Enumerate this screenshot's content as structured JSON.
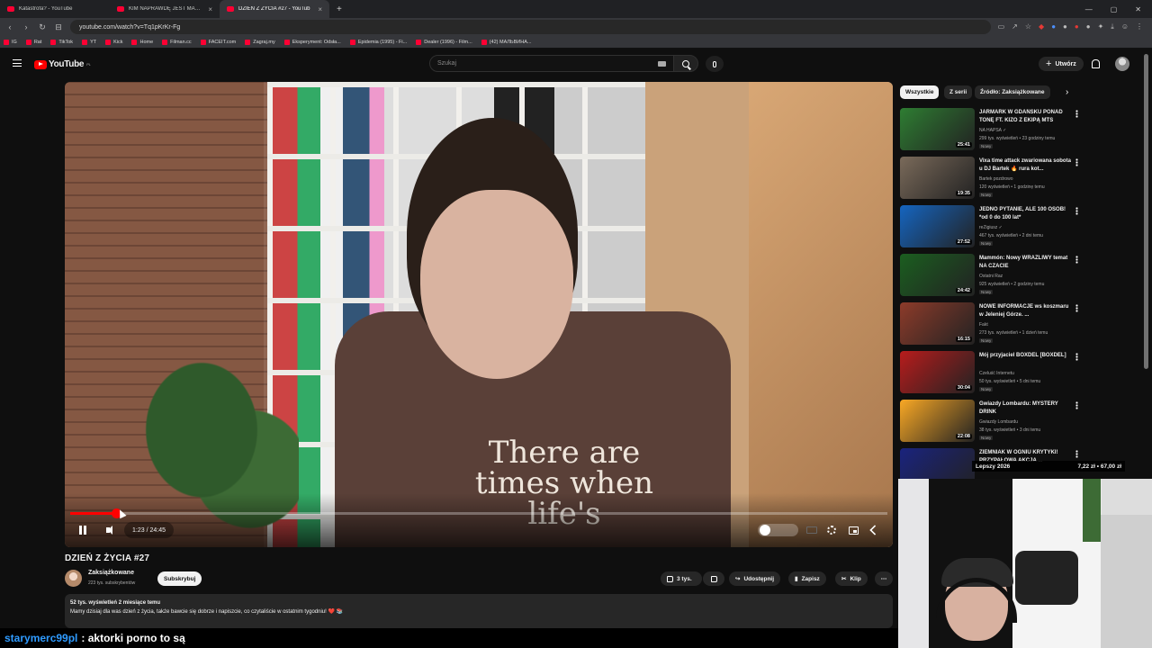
{
  "browser": {
    "tabs": [
      {
        "label": "Katastrofa? - YouTube",
        "active": false
      },
      {
        "label": "KIM NAPRAWDĘ JEST MAKALIER? W",
        "active": false
      },
      {
        "label": "DZIEŃ Z ŻYCIA #27 - YouTub",
        "active": true
      }
    ],
    "url": "youtube.com/watch?v=Tq1pKrKr-Fg",
    "bookmarks": [
      "IG",
      "Rat",
      "TikTok",
      "YT",
      "Kick",
      "Home",
      "Filman.cc",
      "FACEIT.com",
      "Zagraj.my",
      "Eksperyment: Odsła...",
      "Epidemia (1995) - Fi...",
      "Dealer (1996) - Film...",
      "(42) МАЛЬВИНА..."
    ]
  },
  "youtube": {
    "logo": "YouTube",
    "region": "PL",
    "search_placeholder": "Szukaj",
    "create_label": "Utwórz"
  },
  "player": {
    "time_current": "1:23",
    "time_total": "24:45",
    "time_label": "1:23 / 24:45",
    "progress_fraction": 0.056,
    "shirt_text": "There are times when life's"
  },
  "video": {
    "title": "DZIEŃ Z ŻYCIA #27",
    "channel": "Zaksiążkowane",
    "subscribers": "223 tys. subskrybentów",
    "subscribe_label": "Subskrybuj",
    "likes": "3 tys.",
    "share_label": "Udostępnij",
    "save_label": "Zapisz",
    "clip_label": "Klip",
    "stats": "52 tys. wyświetleń  2 miesiące temu",
    "description": "Mamy dzisiaj dla was dzień z życia, także bawcie się dobrze i napiszcie, co czytaliście w ostatnim tygodniu! ❤️ 📚"
  },
  "chips": [
    "Wszystkie",
    "Z serii",
    "Źródło: Zaksiążkowane"
  ],
  "recommendations": [
    {
      "title": "JARMARK W GDAŃSKU PONAD TONĘ FT. KIZO Z EKIPĄ MTS",
      "channel": "NA HAPSA ✓",
      "meta": "299 tys. wyświetleń • 23 godziny temu",
      "badge": "Nowy",
      "duration": "25:41",
      "color": "#2e7d32"
    },
    {
      "title": "Vixa time attack zwariowana sobota u DJ Bartek 🔥 rura kot...",
      "channel": "Bartek pozdrowo",
      "meta": "120 wyświetleń • 1 godzinę temu",
      "badge": "Nowy",
      "duration": "19:35",
      "color": "#7a6a5a"
    },
    {
      "title": "JEDNO PYTANIE, ALE 100 OSÓB! *od 0 do 100 lat*",
      "channel": "reZigiusz ✓",
      "meta": "467 tys. wyświetleń • 2 dni temu",
      "badge": "Nowy",
      "duration": "27:52",
      "color": "#1565c0"
    },
    {
      "title": "Mammón: Nowy WRAŻLIWY temat NA CZACIE",
      "channel": "Ostatni Raz",
      "meta": "925 wyświetleń • 2 godziny temu",
      "badge": "Nowy",
      "duration": "24:42",
      "color": "#1b5e20"
    },
    {
      "title": "NOWE INFORMACJE ws koszmaru w Jeleniej Górze. ...",
      "channel": "Fakt",
      "meta": "273 tys. wyświetleń • 1 dzień temu",
      "badge": "Nowy",
      "duration": "16:15",
      "color": "#8d3b2a"
    },
    {
      "title": "Mój przyjaciel BOXDEL [BOXDEL]",
      "channel": "Czeluść Internetu",
      "meta": "50 tys. wyświetleń • 5 dni temu",
      "badge": "Nowy",
      "duration": "30:04",
      "color": "#b71c1c"
    },
    {
      "title": "Gwiazdy Lombardu: MYSTERY DRINK",
      "channel": "Gwiazdy Lombardu",
      "meta": "38 tys. wyświetleń • 3 dni temu",
      "badge": "Nowy",
      "duration": "22:08",
      "color": "#f9a825"
    },
    {
      "title": "ZIEMNIAK W OGNIU KRYTYKI! PRZYPAŁOWA AKCJA ...",
      "channel": "",
      "meta": "",
      "badge": "",
      "duration": "",
      "color": "#1a237e"
    }
  ],
  "overlay": {
    "price_left": "Lepszy 2026",
    "price_right": "7,22 zł • 67,00 zł",
    "chat_user": "starymerc99pl",
    "chat_message": ": aktorki porno to są"
  }
}
